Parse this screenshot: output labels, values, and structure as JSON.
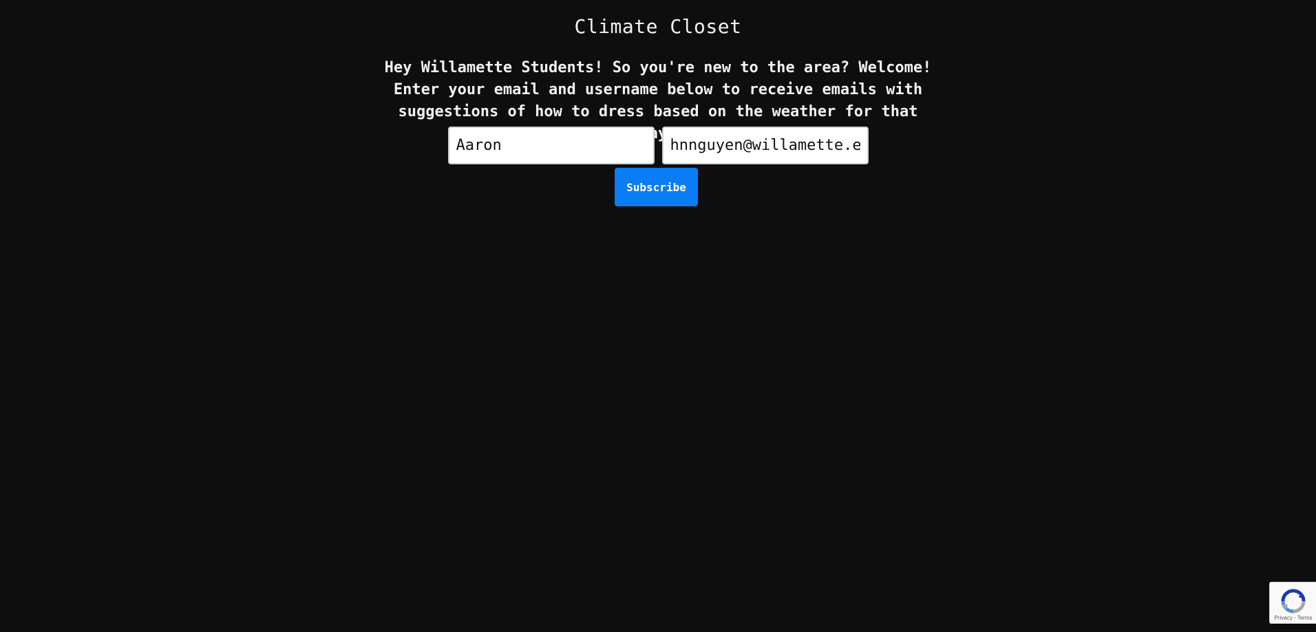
{
  "header": {
    "title": "Climate Closet"
  },
  "intro": {
    "text": "Hey Willamette Students! So you're new to the area? Welcome! Enter your email and username below to receive emails with suggestions of how to dress based on the weather for that day!"
  },
  "form": {
    "username_value": "Aaron",
    "email_value": "hnnguyen@willamette.edu",
    "subscribe_label": "Subscribe"
  },
  "recaptcha": {
    "logo_icon": "recaptcha-icon",
    "privacy_label": "Privacy",
    "separator": " - ",
    "terms_label": "Terms"
  },
  "colors": {
    "background": "#0e0e0f",
    "accent": "#0a7cf4",
    "text": "#f2f2f2"
  }
}
